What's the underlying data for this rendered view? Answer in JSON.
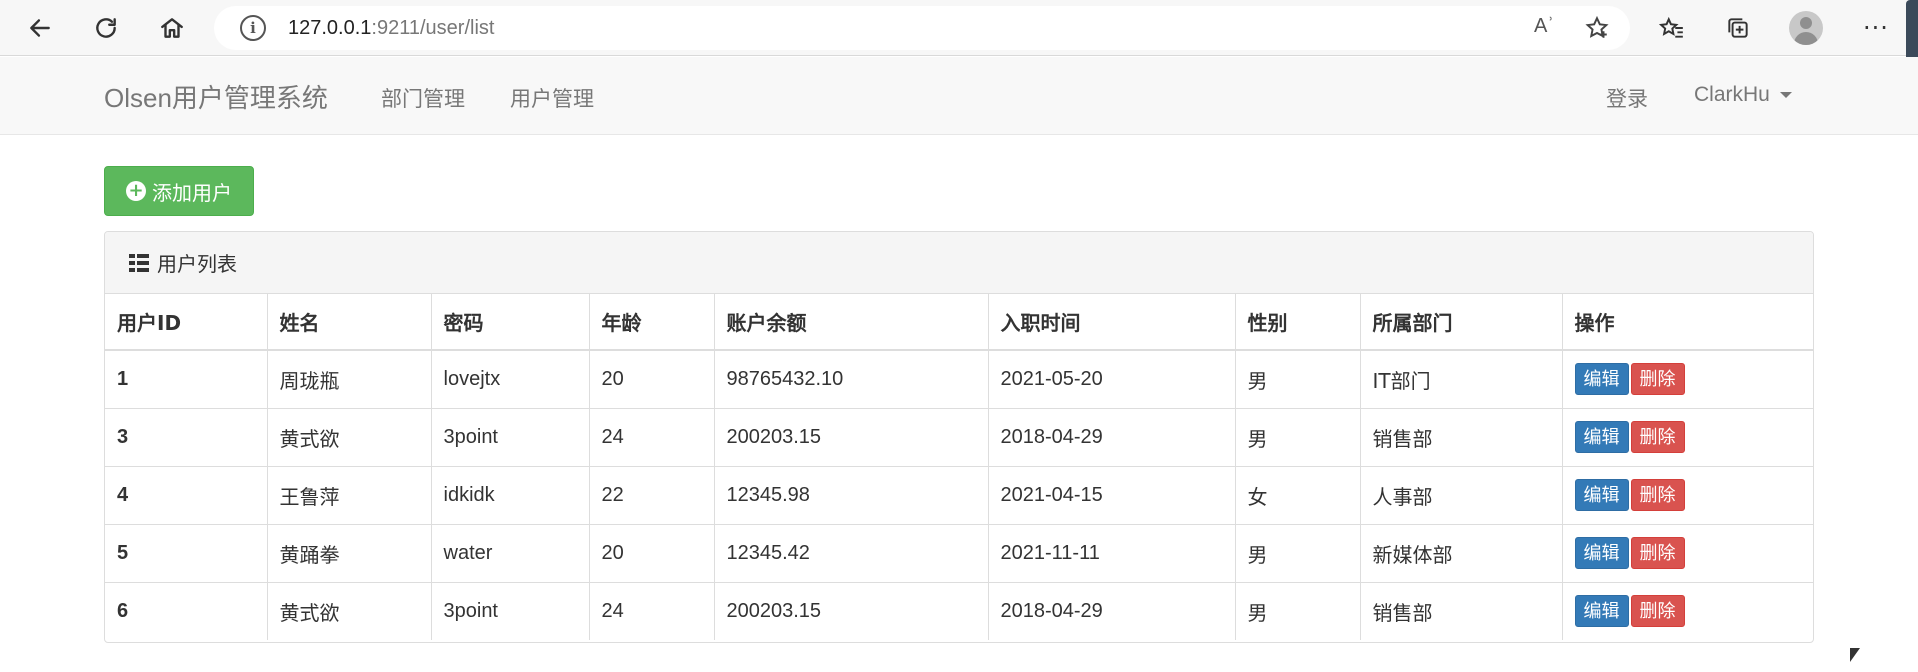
{
  "browser": {
    "url_host": "127.0.0.1",
    "url_rest": ":9211/user/list",
    "read_aloud": "Aʾ"
  },
  "navbar": {
    "brand": "Olsen用户管理系统",
    "links": [
      "部门管理",
      "用户管理"
    ],
    "login": "登录",
    "user": "ClarkHu"
  },
  "add_button": "添加用户",
  "panel": {
    "title": "用户列表",
    "columns": [
      "用户ID",
      "姓名",
      "密码",
      "年龄",
      "账户余额",
      "入职时间",
      "性别",
      "所属部门",
      "操作"
    ],
    "rows": [
      [
        "1",
        "周珑瓶",
        "lovejtx",
        "20",
        "98765432.10",
        "2021-05-20",
        "男",
        "IT部门"
      ],
      [
        "3",
        "黄式欲",
        "3point",
        "24",
        "200203.15",
        "2018-04-29",
        "男",
        "销售部"
      ],
      [
        "4",
        "王鲁萍",
        "idkidk",
        "22",
        "12345.98",
        "2021-04-15",
        "女",
        "人事部"
      ],
      [
        "5",
        "黄踊拳",
        "water",
        "20",
        "12345.42",
        "2021-11-11",
        "男",
        "新媒体部"
      ],
      [
        "6",
        "黄式欲",
        "3point",
        "24",
        "200203.15",
        "2018-04-29",
        "男",
        "销售部"
      ]
    ],
    "edit_label": "编辑",
    "delete_label": "删除"
  },
  "colors": {
    "success": "#5cb85c",
    "primary": "#337ab7",
    "danger": "#d9534f"
  }
}
